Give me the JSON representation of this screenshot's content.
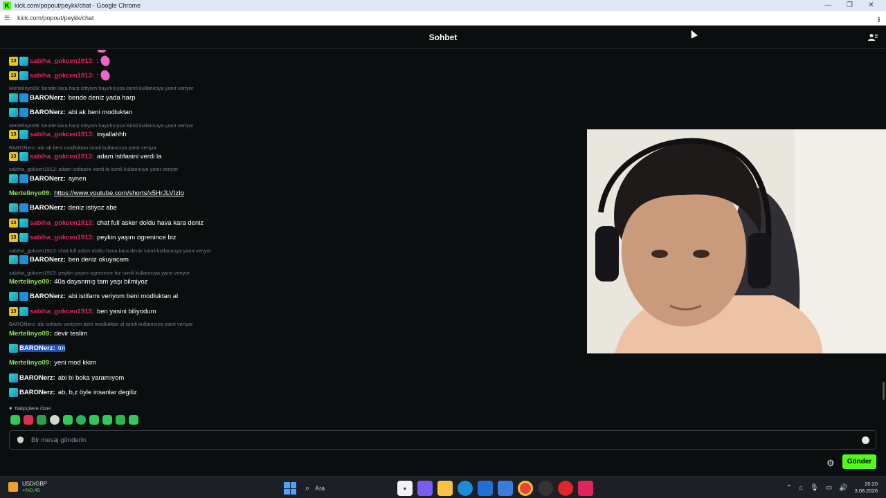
{
  "browser": {
    "window_title": "kick.com/popout/peykk/chat - Google Chrome",
    "url": "kick.com/popout/peykk/chat",
    "controls": [
      "—",
      "❐",
      "✕"
    ]
  },
  "chat": {
    "title": "Sohbet",
    "messages": [
      {
        "type": "msg",
        "user": "sabiha_gokcen1913",
        "text": ""
      },
      {
        "type": "msg",
        "user": "sabiha_gokcen1913",
        "text": ""
      },
      {
        "type": "reply",
        "text": "Mertelinyo09: bende kara harp istiyom hayırlısıysa isimli kullanıcıya yanıt veriyor"
      },
      {
        "type": "msg",
        "user": "BARONerz",
        "text": "bende deniz yada harp"
      },
      {
        "type": "msg",
        "user": "BARONerz",
        "text": "abi ak beni modluktan"
      },
      {
        "type": "reply",
        "text": "Mertelinyo09: bende kara harp istiyom hayırlısıysa isimli kullanıcıya yanıt veriyor"
      },
      {
        "type": "msg",
        "user": "sabiha_gokcen1913",
        "text": "inşallahhh"
      },
      {
        "type": "reply",
        "text": "BARONerz: abi ak beni modluktan isimli kullanıcıya yanıt veriyor"
      },
      {
        "type": "msg",
        "user": "sabiha_gokcen1913",
        "text": "adam istifasini verdi la"
      },
      {
        "type": "reply",
        "text": "sabiha_gokcen1913: adam istifasini verdi la isimli kullanıcıya yanıt veriyor"
      },
      {
        "type": "msg",
        "user": "BARONerz",
        "text": "aynen"
      },
      {
        "type": "msg",
        "user": "Mertelinyo09",
        "text": "https://www.youtube.com/shorts/x5HrJLVIzIo"
      },
      {
        "type": "msg",
        "user": "BARONerz",
        "text": "deniz istiyoz abe"
      },
      {
        "type": "msg",
        "user": "sabiha_gokcen1913",
        "text": "chat full asker doldu hava kara deniz"
      },
      {
        "type": "msg",
        "user": "sabiha_gokcen1913",
        "text": "peykin yaşını ogrenince biz"
      },
      {
        "type": "reply",
        "text": "sabiha_gokcen1913: chat full asker doldu hava kara deniz isimli kullanıcıya yanıt veriyor"
      },
      {
        "type": "msg",
        "user": "BARONerz",
        "text": "ben deniz okuyacam"
      },
      {
        "type": "reply",
        "text": "sabiha_gokcen1913: peykin yaşını ogrenince biz isimli kullanıcıya yanıt veriyor"
      },
      {
        "type": "msg",
        "user": "Mertelinyo09",
        "text": "40a dayanmış tam yaşı bilmiyoz"
      },
      {
        "type": "msg",
        "user": "BARONerz",
        "text": "abi istifamı veriyom beni modluktan al"
      },
      {
        "type": "msg",
        "user": "sabiha_gokcen1913",
        "text": "ben yasini biliyodum"
      },
      {
        "type": "reply",
        "text": "BARONerz: abi istifamı veriyom beni modluktan al isimli kullanıcıya yanıt veriyor"
      },
      {
        "type": "msg",
        "user": "Mertelinyo09",
        "text": "devir teslim"
      },
      {
        "type": "msg",
        "user": "BARONerz",
        "text": "tm"
      },
      {
        "type": "msg",
        "user": "Mertelinyo09",
        "text": "yeni mod kkim"
      },
      {
        "type": "msg",
        "user": "BARONerz",
        "text": "abi bi boka yaramıyom"
      },
      {
        "type": "msg",
        "user": "BARONerz",
        "text": "ab, b,z öyle insanlar degiliz"
      }
    ],
    "sub_badge": "13",
    "followers_label": "Takipçilere Özel",
    "input_placeholder": "Bir mesaj gönderin",
    "send_label": "Gönder"
  },
  "taskbar": {
    "ticker_name": "USD/GBP",
    "ticker_change": "+%0,45",
    "search_label": "Ara",
    "time": "20:20",
    "date": "3.08.2026"
  },
  "colors": {
    "accent": "#53fc18",
    "username_pink": "#e0245e",
    "username_green": "#8fe35a"
  }
}
